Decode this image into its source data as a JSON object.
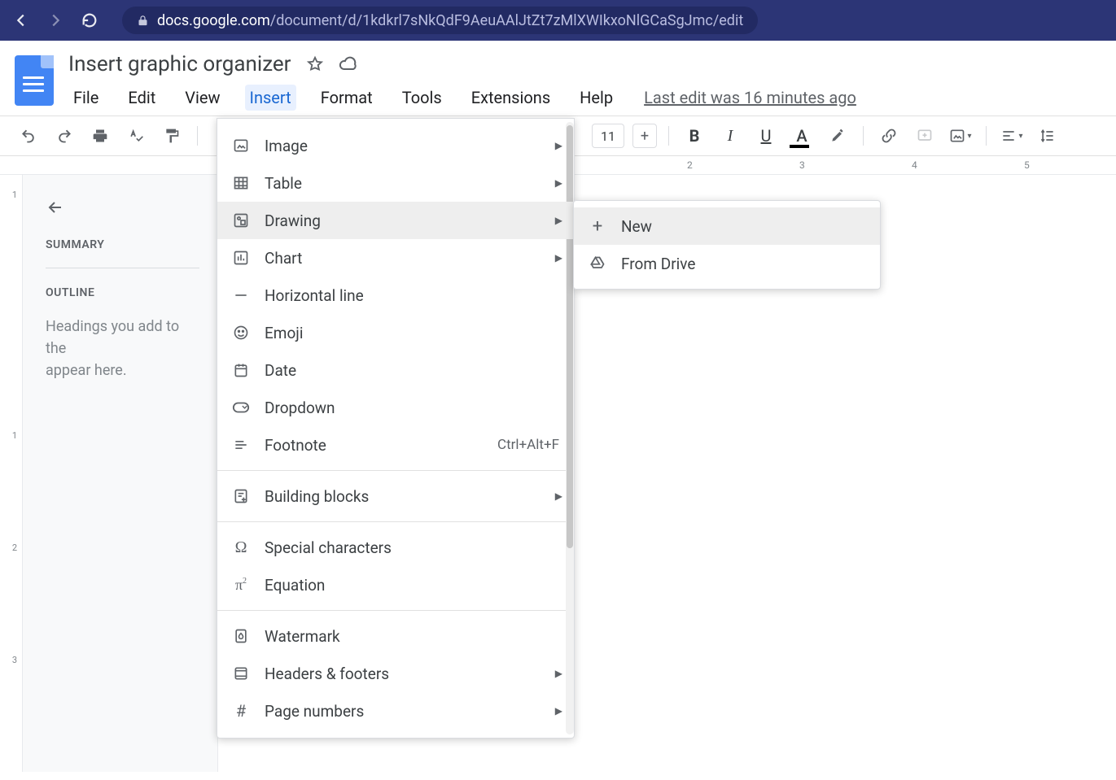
{
  "browser": {
    "url_host": "docs.google.com",
    "url_path": "/document/d/1kdkrl7sNkQdF9AeuAAlJtZt7zMlXWIkxoNlGCaSgJmc/edit"
  },
  "doc": {
    "title": "Insert graphic organizer",
    "last_edit": "Last edit was 16 minutes ago"
  },
  "menus": {
    "file": "File",
    "edit": "Edit",
    "view": "View",
    "insert": "Insert",
    "format": "Format",
    "tools": "Tools",
    "extensions": "Extensions",
    "help": "Help"
  },
  "toolbar": {
    "font_size": "11",
    "bold": "B",
    "italic": "I",
    "underline": "U",
    "text_color": "A"
  },
  "ruler": {
    "n2": "2",
    "n3": "3",
    "n4": "4",
    "n5": "5"
  },
  "gutter": {
    "n1a": "1",
    "n1b": "1",
    "n2": "2",
    "n3": "3"
  },
  "sidebar": {
    "summary": "SUMMARY",
    "outline": "OUTLINE",
    "hint": "Headings you add to the\nappear here."
  },
  "insert_menu": {
    "image": "Image",
    "table": "Table",
    "drawing": "Drawing",
    "chart": "Chart",
    "hline": "Horizontal line",
    "emoji": "Emoji",
    "date": "Date",
    "dropdown": "Dropdown",
    "footnote": "Footnote",
    "footnote_shortcut": "Ctrl+Alt+F",
    "building_blocks": "Building blocks",
    "special_chars": "Special characters",
    "equation": "Equation",
    "watermark": "Watermark",
    "headers_footers": "Headers & footers",
    "page_numbers": "Page numbers"
  },
  "drawing_submenu": {
    "new": "New",
    "from_drive": "From Drive"
  }
}
